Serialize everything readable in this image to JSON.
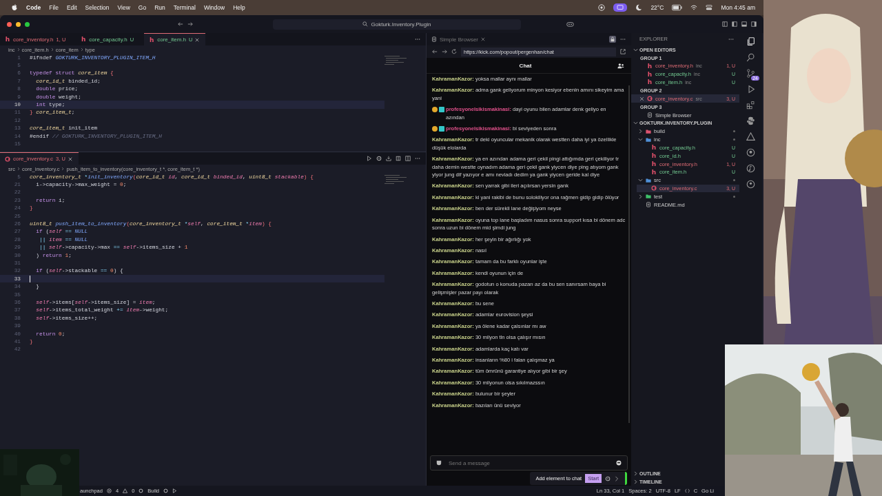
{
  "menu_bar": {
    "app": "Code",
    "items": [
      "File",
      "Edit",
      "Selection",
      "View",
      "Go",
      "Run",
      "Terminal",
      "Window",
      "Help"
    ],
    "temperature": "22°C",
    "clock": "Mon 4:45 am"
  },
  "window": {
    "title": "Gokturk.Inventory.Plugin"
  },
  "editor_top": {
    "tabs": [
      {
        "name": "core_inventory.h",
        "kind": "header",
        "glyph": "h",
        "badge": "1, U",
        "error": true,
        "selected": false
      },
      {
        "name": "core_capacity.h",
        "kind": "header",
        "glyph": "h",
        "badge": "U",
        "error": false,
        "selected": false
      },
      {
        "name": "core_item.h",
        "kind": "header",
        "glyph": "h",
        "badge": "U",
        "error": false,
        "selected": true
      }
    ],
    "breadcrumb": [
      "inc",
      "core_item.h",
      "core_item",
      "type"
    ],
    "lines": [
      {
        "n": "1",
        "current": false,
        "tokens": [
          {
            "kind": "plain",
            "text": "#ifndef"
          },
          {
            "kind": "macro",
            "text": " GOKTURK_INVENTORY_PLUGIN_ITEM_H"
          }
        ]
      },
      {
        "n": "5",
        "current": false
      },
      {
        "n": "6",
        "current": false,
        "tokens": [
          {
            "kind": "kw",
            "text": "typedef struct"
          },
          {
            "kind": "type",
            "text": " core_item"
          },
          {
            "kind": "punct",
            "text": " {"
          }
        ]
      },
      {
        "n": "7",
        "current": false,
        "tokens": [
          {
            "kind": "type",
            "text": "  core_id_t"
          },
          {
            "kind": "plain",
            "text": " binded_id;"
          }
        ]
      },
      {
        "n": "8",
        "current": false,
        "tokens": [
          {
            "kind": "kw",
            "text": "  double"
          },
          {
            "kind": "plain",
            "text": " price;"
          }
        ]
      },
      {
        "n": "9",
        "current": false,
        "tokens": [
          {
            "kind": "kw",
            "text": "  double"
          },
          {
            "kind": "plain",
            "text": " weight;"
          }
        ]
      },
      {
        "n": "10",
        "current": true,
        "tokens": [
          {
            "kind": "kw",
            "text": "  int"
          },
          {
            "kind": "plain",
            "text": " type;"
          }
        ]
      },
      {
        "n": "11",
        "current": false,
        "tokens": [
          {
            "kind": "punct",
            "text": "}"
          },
          {
            "kind": "type",
            "text": " core_item_t"
          },
          {
            "kind": "plain",
            "text": ";"
          }
        ]
      },
      {
        "n": "12",
        "current": false
      },
      {
        "n": "13",
        "current": false,
        "tokens": [
          {
            "kind": "type",
            "text": "core_item_t"
          },
          {
            "kind": "plain",
            "text": " init_item"
          }
        ]
      },
      {
        "n": "14",
        "current": false,
        "tokens": [
          {
            "kind": "plain",
            "text": "#endif"
          },
          {
            "kind": "comment",
            "text": " // GOKTURK_INVENTORY_PLUGIN_ITEM_H"
          }
        ]
      },
      {
        "n": "15",
        "current": false
      }
    ]
  },
  "editor_bottom": {
    "tabs": [
      {
        "name": "core_inventory.c",
        "kind": "source",
        "badge": "3, U",
        "error": true,
        "selected": true
      }
    ],
    "breadcrumb": [
      "src",
      "core_inventory.c",
      "push_item_to_inventory(core_inventory_t *, core_item_t *)"
    ],
    "lines": [
      {
        "n": "5",
        "current": false,
        "tokens": [
          {
            "kind": "type",
            "text": "core_inventory_t"
          },
          {
            "kind": "op",
            "text": " *"
          },
          {
            "kind": "fn",
            "text": "init_inventory"
          },
          {
            "kind": "punct",
            "text": "("
          },
          {
            "kind": "type",
            "text": "core_id_t"
          },
          {
            "kind": "var",
            "text": " id"
          },
          {
            "kind": "plain",
            "text": ","
          },
          {
            "kind": "type",
            "text": " core_id_t"
          },
          {
            "kind": "var",
            "text": " binded_id"
          },
          {
            "kind": "plain",
            "text": ","
          },
          {
            "kind": "type",
            "text": " uint8_t"
          },
          {
            "kind": "var",
            "text": " stackable"
          },
          {
            "kind": "punct",
            "text": ") {"
          }
        ]
      },
      {
        "n": "21",
        "current": false,
        "tokens": [
          {
            "kind": "plain",
            "text": "  i->capacity->max_weight ="
          },
          {
            "kind": "num",
            "text": " 0"
          },
          {
            "kind": "plain",
            "text": ";"
          }
        ]
      },
      {
        "n": "22",
        "current": false
      },
      {
        "n": "23",
        "current": false,
        "tokens": [
          {
            "kind": "kw",
            "text": "  return"
          },
          {
            "kind": "plain",
            "text": " i;"
          }
        ]
      },
      {
        "n": "24",
        "current": false,
        "tokens": [
          {
            "kind": "punct",
            "text": "}"
          }
        ]
      },
      {
        "n": "25",
        "current": false
      },
      {
        "n": "26",
        "current": false,
        "tokens": [
          {
            "kind": "type",
            "text": "uint8_t"
          },
          {
            "kind": "fn",
            "text": " push_item_to_inventory"
          },
          {
            "kind": "punct",
            "text": "("
          },
          {
            "kind": "type",
            "text": "core_inventory_t"
          },
          {
            "kind": "op",
            "text": " *"
          },
          {
            "kind": "var",
            "text": "self"
          },
          {
            "kind": "plain",
            "text": ","
          },
          {
            "kind": "type",
            "text": " core_item_t"
          },
          {
            "kind": "op",
            "text": " *"
          },
          {
            "kind": "var",
            "text": "item"
          },
          {
            "kind": "punct",
            "text": ") {"
          }
        ]
      },
      {
        "n": "27",
        "current": false,
        "tokens": [
          {
            "kind": "kw",
            "text": "  if"
          },
          {
            "kind": "plain",
            "text": " ("
          },
          {
            "kind": "var",
            "text": "self"
          },
          {
            "kind": "op",
            "text": " =="
          },
          {
            "kind": "macro",
            "text": " NULL"
          }
        ]
      },
      {
        "n": "28",
        "current": false,
        "tokens": [
          {
            "kind": "op",
            "text": "   ||"
          },
          {
            "kind": "var",
            "text": " item"
          },
          {
            "kind": "op",
            "text": " =="
          },
          {
            "kind": "macro",
            "text": " NULL"
          }
        ]
      },
      {
        "n": "29",
        "current": false,
        "tokens": [
          {
            "kind": "op",
            "text": "   ||"
          },
          {
            "kind": "var",
            "text": " self"
          },
          {
            "kind": "plain",
            "text": "->capacity->max"
          },
          {
            "kind": "op",
            "text": " =="
          },
          {
            "kind": "var",
            "text": " self"
          },
          {
            "kind": "plain",
            "text": "->items_size +"
          },
          {
            "kind": "num",
            "text": " 1"
          }
        ]
      },
      {
        "n": "30",
        "current": false,
        "tokens": [
          {
            "kind": "plain",
            "text": "  )"
          },
          {
            "kind": "kw",
            "text": " return"
          },
          {
            "kind": "num",
            "text": " 1"
          },
          {
            "kind": "plain",
            "text": ";"
          }
        ]
      },
      {
        "n": "31",
        "current": false
      },
      {
        "n": "32",
        "current": false,
        "tokens": [
          {
            "kind": "kw",
            "text": "  if"
          },
          {
            "kind": "plain",
            "text": " ("
          },
          {
            "kind": "var",
            "text": "self"
          },
          {
            "kind": "plain",
            "text": "->stackable"
          },
          {
            "kind": "op",
            "text": " =="
          },
          {
            "kind": "num",
            "text": " 0"
          },
          {
            "kind": "plain",
            "text": ") {"
          }
        ]
      },
      {
        "n": "33",
        "current": true
      },
      {
        "n": "34",
        "current": false,
        "tokens": [
          {
            "kind": "plain",
            "text": "  }"
          }
        ]
      },
      {
        "n": "35",
        "current": false
      },
      {
        "n": "36",
        "current": false,
        "tokens": [
          {
            "kind": "var",
            "text": "  self"
          },
          {
            "kind": "plain",
            "text": "->items["
          },
          {
            "kind": "var",
            "text": "self"
          },
          {
            "kind": "plain",
            "text": "->items_size] ="
          },
          {
            "kind": "var",
            "text": " item"
          },
          {
            "kind": "plain",
            "text": ";"
          }
        ]
      },
      {
        "n": "37",
        "current": false,
        "tokens": [
          {
            "kind": "var",
            "text": "  self"
          },
          {
            "kind": "plain",
            "text": "->items_total_weight"
          },
          {
            "kind": "op",
            "text": " +="
          },
          {
            "kind": "var",
            "text": " item"
          },
          {
            "kind": "plain",
            "text": "->weight;"
          }
        ]
      },
      {
        "n": "38",
        "current": false,
        "tokens": [
          {
            "kind": "var",
            "text": "  self"
          },
          {
            "kind": "plain",
            "text": "->items_size++;"
          }
        ]
      },
      {
        "n": "39",
        "current": false
      },
      {
        "n": "40",
        "current": false,
        "tokens": [
          {
            "kind": "kw",
            "text": "  return"
          },
          {
            "kind": "num",
            "text": " 0"
          },
          {
            "kind": "plain",
            "text": ";"
          }
        ]
      },
      {
        "n": "41",
        "current": false,
        "tokens": [
          {
            "kind": "punct",
            "text": "}"
          }
        ]
      },
      {
        "n": "42",
        "current": false
      }
    ]
  },
  "browser": {
    "tab": "Simple Browser",
    "url": "https://kick.com/popout/pergenhan/chat",
    "chat_title": "Chat",
    "messages": [
      {
        "user": "KahramanKazor:",
        "color": "#c8d18a",
        "badges": false,
        "text": "yoksa mallar aynı mallar"
      },
      {
        "user": "KahramanKazor:",
        "color": "#c8d18a",
        "badges": false,
        "text": "adma gank geliyorum minyon kesiyor ebenin amını sikeyim ama yani"
      },
      {
        "user": "profesyonelsikismakinasi:",
        "color": "#e0508a",
        "badges": true,
        "text": "dayi oyunu bilen adamlar denk geliyo en azından"
      },
      {
        "user": "profesyonelsikismakinasi:",
        "color": "#e0508a",
        "badges": true,
        "text": "bi seviyeden sonra"
      },
      {
        "user": "KahramanKazor:",
        "color": "#c8d18a",
        "badges": false,
        "text": "tr deki oyuncular mekanik olarak westten daha iyi ya özellikle düşük elolarda"
      },
      {
        "user": "KahramanKazor:",
        "color": "#c8d18a",
        "badges": false,
        "text": "ya en azından adama geri çekil pingi attığımda geri çekiliyor tr daha demin westte oynadım adama geri çekil gank yiycen diye ping atıyom gank yiyor jung dif yazıyor e amı neviadı dedim ya gank yiycen geride kal diye"
      },
      {
        "user": "KahramanKazor:",
        "color": "#c8d18a",
        "badges": false,
        "text": "sen yarrak gibi ileri açılırsan yersin gank"
      },
      {
        "user": "KahramanKazor:",
        "color": "#c8d18a",
        "badges": false,
        "text": "ki yani rakibi de bunu solokiliyor ona rağmen gidip gidip ölüyor"
      },
      {
        "user": "KahramanKazor:",
        "color": "#c8d18a",
        "badges": false,
        "text": "ben der sürekli lane değişiyom neyse"
      },
      {
        "user": "KahramanKazor:",
        "color": "#c8d18a",
        "badges": false,
        "text": "oyuna top lane başladım nasus sonra support kısa bi dönem adc sonra uzun bi dönem mid şimdi jung"
      },
      {
        "user": "KahramanKazor:",
        "color": "#c8d18a",
        "badges": false,
        "text": "her şeyin bir ağırlığı yok"
      },
      {
        "user": "KahramanKazor:",
        "color": "#c8d18a",
        "badges": false,
        "text": "nasıl"
      },
      {
        "user": "KahramanKazor:",
        "color": "#c8d18a",
        "badges": false,
        "text": "tamam da bu farklı oyunlar işte"
      },
      {
        "user": "KahramanKazor:",
        "color": "#c8d18a",
        "badges": false,
        "text": "kendi oyunun için de"
      },
      {
        "user": "KahramanKazor:",
        "color": "#c8d18a",
        "badges": false,
        "text": "godotun o konuda pazarı az da bu sen sanırsam baya bi gelişmişler pazar payı olarak"
      },
      {
        "user": "KahramanKazor:",
        "color": "#c8d18a",
        "badges": false,
        "text": "bu sene"
      },
      {
        "user": "KahramanKazor:",
        "color": "#c8d18a",
        "badges": false,
        "text": "adamlar eurovision şeysi"
      },
      {
        "user": "KahramanKazor:",
        "color": "#c8d18a",
        "badges": false,
        "text": "ya ölene kadar çalsınlar mı aw"
      },
      {
        "user": "KahramanKazor:",
        "color": "#c8d18a",
        "badges": false,
        "text": "30 milyon tln olsa çalışır mısın"
      },
      {
        "user": "KahramanKazor:",
        "color": "#c8d18a",
        "badges": false,
        "text": "adamlarda kaç katı var"
      },
      {
        "user": "KahramanKazor:",
        "color": "#c8d18a",
        "badges": false,
        "text": "insanların %80 i falan çalışmaz ya"
      },
      {
        "user": "KahramanKazor:",
        "color": "#c8d18a",
        "badges": false,
        "text": "tüm ömrünü garantiye alıyor gibi bir şey"
      },
      {
        "user": "KahramanKazor:",
        "color": "#c8d18a",
        "badges": false,
        "text": "30 milyonun olsa sıkılmazssın"
      },
      {
        "user": "KahramanKazor:",
        "color": "#c8d18a",
        "badges": false,
        "text": "bulunur bir şeyler"
      },
      {
        "user": "KahramanKazor:",
        "color": "#c8d18a",
        "badges": false,
        "text": "bazıları ünü seviyor"
      }
    ],
    "input": {
      "placeholder": "Send a message"
    },
    "popup": {
      "label": "Add element to chat",
      "button": "Start"
    }
  },
  "explorer": {
    "title": "EXPLORER",
    "open_editors": {
      "title": "OPEN EDITORS",
      "expanded": true,
      "groups": [
        {
          "title": "GROUP 1",
          "items": [
            {
              "name": "core_inventory.h",
              "kind": "header",
              "glyph": "h",
              "folder": "inc",
              "badge": "1, U",
              "error": true,
              "selected": false
            },
            {
              "name": "core_capacity.h",
              "kind": "header",
              "glyph": "h",
              "folder": "inc",
              "badge": "U",
              "error": false,
              "selected": false
            },
            {
              "name": "core_item.h",
              "kind": "header",
              "glyph": "h",
              "folder": "inc",
              "badge": "U",
              "error": false,
              "selected": false
            }
          ]
        },
        {
          "title": "GROUP 2",
          "items": [
            {
              "name": "core_inventory.c",
              "kind": "source",
              "folder": "src",
              "badge": "3, U",
              "error": true,
              "selected": true
            }
          ]
        },
        {
          "title": "GROUP 3",
          "items": [
            {
              "name": "Simple Browser",
              "kind": "browser",
              "selected": false
            }
          ]
        }
      ]
    },
    "project": {
      "title": "GOKTURK.INVENTORY.PLUGIN",
      "expanded": true,
      "tree": [
        {
          "name": "build",
          "kind": "folder",
          "color": "#d9536f",
          "expanded": false
        },
        {
          "name": "inc",
          "kind": "folder",
          "color": "#4f8fd6",
          "expanded": true,
          "children": [
            {
              "name": "core_capacity.h",
              "kind": "header",
              "glyph": "h",
              "badge": "U",
              "error": false,
              "selected": false
            },
            {
              "name": "core_id.h",
              "kind": "header",
              "glyph": "h",
              "badge": "U",
              "error": false,
              "selected": false
            },
            {
              "name": "core_inventory.h",
              "kind": "header",
              "glyph": "h",
              "badge": "1, U",
              "error": true,
              "selected": false
            },
            {
              "name": "core_item.h",
              "kind": "header",
              "glyph": "h",
              "badge": "U",
              "error": false,
              "selected": false
            }
          ]
        },
        {
          "name": "src",
          "kind": "folder",
          "color": "#4f8fd6",
          "expanded": true,
          "children": [
            {
              "name": "core_inventory.c",
              "kind": "source",
              "badge": "3, U",
              "error": true,
              "selected": true
            }
          ]
        },
        {
          "name": "test",
          "kind": "folder",
          "color": "#3fbf6a",
          "expanded": false
        },
        {
          "name": "README.md",
          "kind": "document"
        }
      ]
    },
    "outline": "OUTLINE",
    "timeline": "TIMELINE"
  },
  "activity_bar": {
    "source_control_badge": "24"
  },
  "status_bar": {
    "launcher": "aunchpad",
    "errors": "4",
    "warnings": "0",
    "build": "Build",
    "position": "Ln 33, Col 1",
    "indent": "Spaces: 2",
    "encoding": "UTF-8",
    "eol": "LF",
    "language": "C",
    "live": "Go Li"
  }
}
